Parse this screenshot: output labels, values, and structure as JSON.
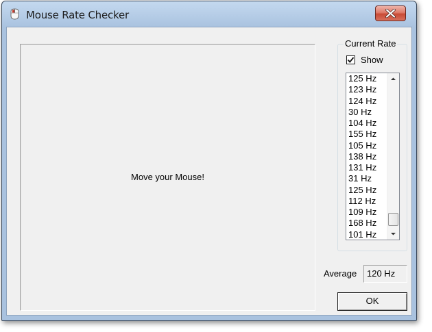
{
  "window": {
    "title": "Mouse Rate Checker",
    "app_icon": "mouse-app-icon",
    "close_icon": "close-icon"
  },
  "mouse_area": {
    "label": "Move your Mouse!"
  },
  "current_rate": {
    "group_title": "Current Rate",
    "show_label": "Show",
    "show_checked": true,
    "items": [
      "125 Hz",
      "123 Hz",
      "124 Hz",
      "30 Hz",
      "104 Hz",
      "155 Hz",
      "105 Hz",
      "138 Hz",
      "131 Hz",
      "31 Hz",
      "125 Hz",
      "112 Hz",
      "109 Hz",
      "168 Hz",
      "101 Hz"
    ]
  },
  "average": {
    "label": "Average",
    "value": "120 Hz"
  },
  "buttons": {
    "ok_label": "OK"
  }
}
